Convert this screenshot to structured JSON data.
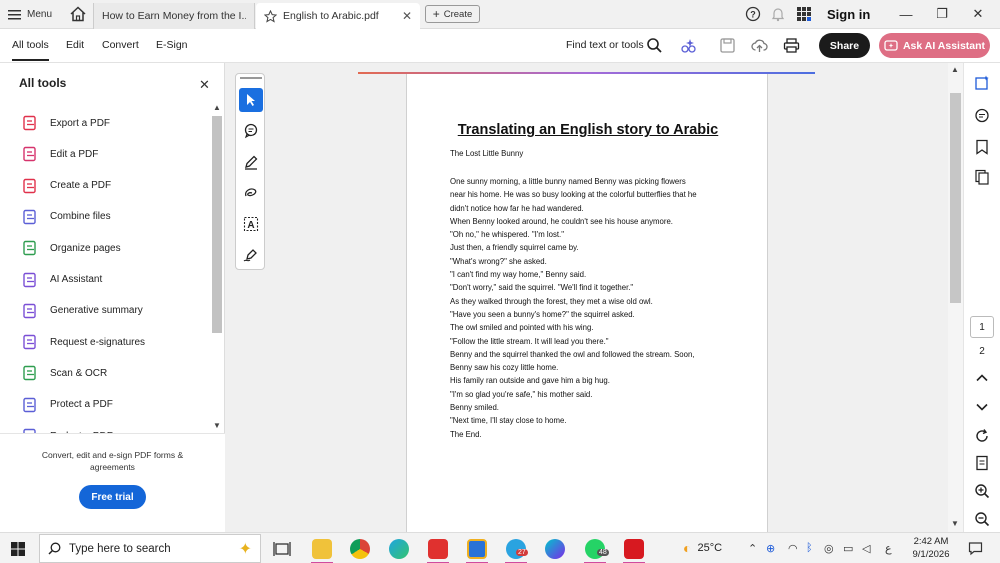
{
  "titlebar": {
    "menu_label": "Menu",
    "tabs": [
      {
        "label": "How to Earn Money from the I..."
      },
      {
        "label": "English to Arabic.pdf"
      }
    ],
    "create_label": "Create",
    "signin_label": "Sign in"
  },
  "toolbar": {
    "menus": [
      "All tools",
      "Edit",
      "Convert",
      "E-Sign"
    ],
    "find_label": "Find text or tools",
    "share_label": "Share",
    "ai_label": "Ask AI Assistant",
    "ai_color": "#de6e84"
  },
  "leftpanel": {
    "title": "All tools",
    "items": [
      {
        "label": "Export a PDF",
        "icon": "export-pdf-icon",
        "color": "#e0314b"
      },
      {
        "label": "Edit a PDF",
        "icon": "edit-pdf-icon",
        "color": "#d6336c"
      },
      {
        "label": "Create a PDF",
        "icon": "create-pdf-icon",
        "color": "#e0314b"
      },
      {
        "label": "Combine files",
        "icon": "combine-files-icon",
        "color": "#5b5fd6"
      },
      {
        "label": "Organize pages",
        "icon": "organize-pages-icon",
        "color": "#2e9d4f"
      },
      {
        "label": "AI Assistant",
        "icon": "ai-assistant-icon",
        "color": "#7a4fd6"
      },
      {
        "label": "Generative summary",
        "icon": "generative-summary-icon",
        "color": "#7a4fd6"
      },
      {
        "label": "Request e-signatures",
        "icon": "request-esignature-icon",
        "color": "#7a4fd6"
      },
      {
        "label": "Scan & OCR",
        "icon": "scan-ocr-icon",
        "color": "#2e9d4f"
      },
      {
        "label": "Protect a PDF",
        "icon": "protect-pdf-icon",
        "color": "#5b5fd6"
      },
      {
        "label": "Redact a PDF",
        "icon": "redact-pdf-icon",
        "color": "#5b5fd6"
      }
    ],
    "footer_text": "Convert, edit and e-sign PDF forms & agreements",
    "free_trial_label": "Free trial",
    "accent": "#1466d8"
  },
  "document": {
    "title": "Translating an English story to Arabic",
    "subtitle": "The Lost Little Bunny",
    "lines": [
      "One sunny morning, a little bunny named Benny was picking flowers",
      "near his home. He was so busy looking at the colorful butterflies that he",
      "didn't notice how far he had wandered.",
      "When Benny looked around, he couldn't see his house anymore.",
      "\"Oh no,\" he whispered. \"I'm lost.\"",
      "Just then, a friendly squirrel came by.",
      "\"What's wrong?\" she asked.",
      "\"I can't find my way home,\" Benny said.",
      "\"Don't worry,\" said the squirrel. \"We'll find it together.\"",
      "As they walked through the forest, they met a wise old owl.",
      "\"Have you seen a bunny's home?\" the squirrel asked.",
      "The owl smiled and pointed with his wing.",
      "\"Follow the little stream. It will lead you there.\"",
      "Benny and the squirrel thanked the owl and followed the stream. Soon,",
      "Benny saw his cozy little home.",
      "His family ran outside and gave him a big hug.",
      "\"I'm so glad you're safe,\" his mother said.",
      "Benny smiled.",
      "\"Next time, I'll stay close to home.",
      "The End."
    ]
  },
  "pagenav": {
    "current": "1",
    "total": "2"
  },
  "taskbar": {
    "search_placeholder": "Type here to search",
    "temperature": "25°C",
    "time": "2:42 AM",
    "date": "9/1/2026",
    "badge_telegram": "27",
    "badge_whatsapp": "48"
  }
}
